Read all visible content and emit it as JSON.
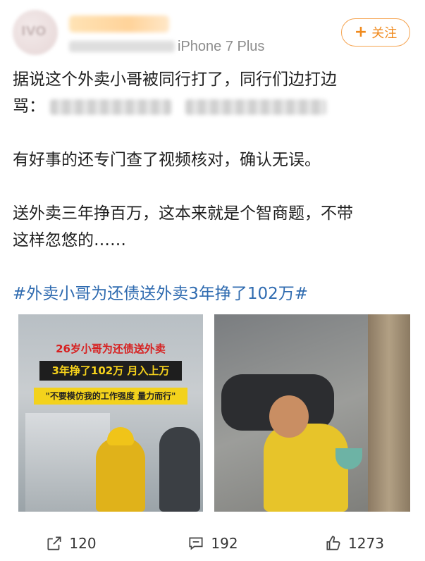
{
  "header": {
    "device": "iPhone 7 Plus",
    "follow_label": "关注"
  },
  "post": {
    "line1": "据说这个外卖小哥被同行打了，同行们边打边",
    "line2_prefix": "骂：",
    "line3": "有好事的还专门查了视频核对，确认无误。",
    "line4": "送外卖三年挣百万，这本来就是个智商题，不带",
    "line5": "这样忽悠的……",
    "hashtag": "#外卖小哥为还债送外卖3年挣了102万#"
  },
  "images": {
    "left": {
      "caption1": "26岁小哥为还债送外卖",
      "caption2": "3年挣了102万 月入上万",
      "caption3": "\"不要模仿我的工作强度 量力而行\""
    }
  },
  "actions": {
    "share_count": "120",
    "comment_count": "192",
    "like_count": "1273"
  },
  "icons": [
    "share-icon",
    "comment-icon",
    "thumbs-up-icon"
  ]
}
